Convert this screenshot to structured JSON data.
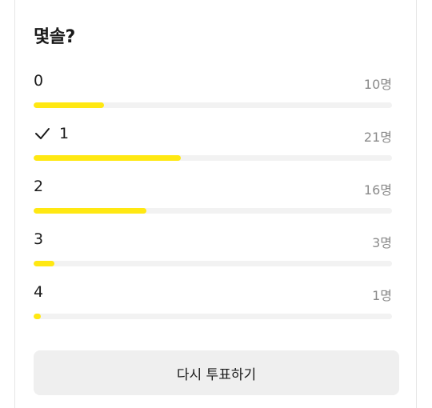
{
  "poll": {
    "title": "몇솔?",
    "options": [
      {
        "label": "0",
        "count": "10명",
        "votes": 10,
        "selected": false
      },
      {
        "label": "1",
        "count": "21명",
        "votes": 21,
        "selected": true
      },
      {
        "label": "2",
        "count": "16명",
        "votes": 16,
        "selected": false
      },
      {
        "label": "3",
        "count": "3명",
        "votes": 3,
        "selected": false
      },
      {
        "label": "4",
        "count": "1명",
        "votes": 1,
        "selected": false
      }
    ],
    "revote_label": "다시 투표하기",
    "bar_color": "#ffe812",
    "track_color": "#f2f2f2"
  }
}
